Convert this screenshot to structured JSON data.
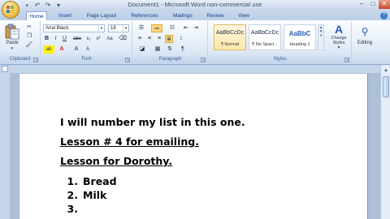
{
  "window": {
    "title": "Document1 - Microsoft Word non-commercial use",
    "controls": [
      "–",
      "□",
      "✕"
    ]
  },
  "tabs": [
    "Home",
    "Insert",
    "Page Layout",
    "References",
    "Mailings",
    "Review",
    "View"
  ],
  "ribbon": {
    "clipboard": {
      "label": "Clipboard",
      "paste": "Paste"
    },
    "font": {
      "label": "Font",
      "family": "Arial Black",
      "size": "18",
      "bold": "B",
      "italic": "I",
      "underline": "U",
      "strike": "abe",
      "subscript": "x₂",
      "superscript": "x²",
      "change_case": "Aa",
      "highlight": "ab",
      "font_color": "A",
      "grow": "A",
      "shrink": "A"
    },
    "paragraph": {
      "label": "Paragraph",
      "pilcrow": "¶"
    },
    "styles": {
      "label": "Styles",
      "items": [
        {
          "sample": "AaBbCcDc",
          "name": "¶ Normal"
        },
        {
          "sample": "AaBbCcDc",
          "name": "¶ No Spaci..."
        },
        {
          "sample": "AaBbC",
          "name": "Heading 1"
        }
      ],
      "change_styles": "Change Styles",
      "change_styles_arrow": "▾"
    },
    "editing": {
      "label": "Editing"
    }
  },
  "document": {
    "line1": "I will number my list in this one.",
    "line2": "Lesson # 4 for emailing.",
    "line3": "Lesson for Dorothy.",
    "list": [
      {
        "num": "1.",
        "text": "Bread"
      },
      {
        "num": "2.",
        "text": "Milk"
      },
      {
        "num": "3.",
        "text": ""
      }
    ]
  },
  "colors": {
    "accent": "#15428b",
    "ribbon_bg": "#dfe9f5",
    "frame": "#aebfd8"
  }
}
